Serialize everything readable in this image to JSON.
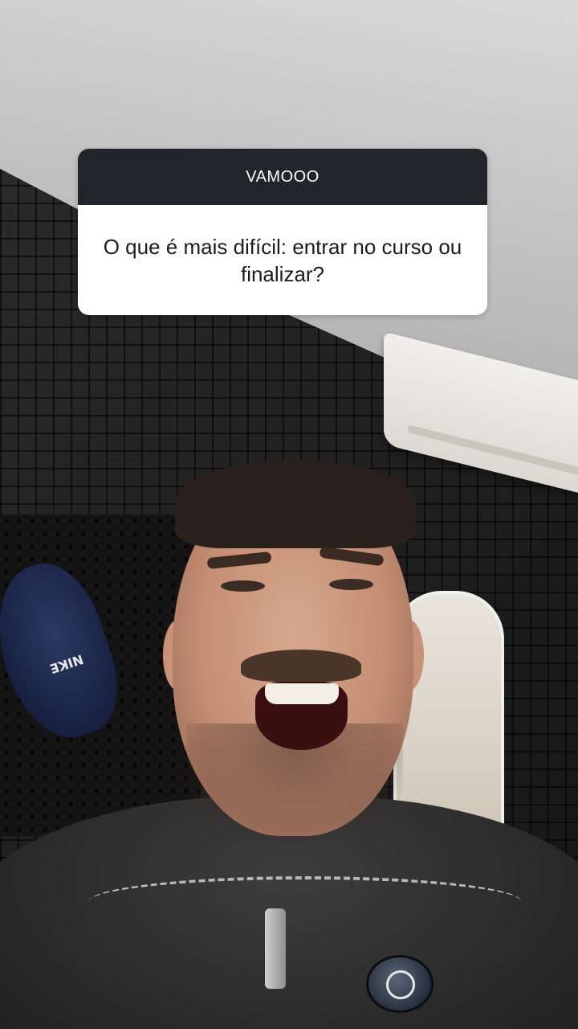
{
  "question_sticker": {
    "header": "VAMOOO",
    "question": "O que é mais difícil: entrar no curso ou finalizar?"
  },
  "background": {
    "cap_logo_text": "NIKE",
    "colors": {
      "card_header": "#22262b",
      "card_body": "#ffffff",
      "wall": "#1b1b1b"
    }
  }
}
